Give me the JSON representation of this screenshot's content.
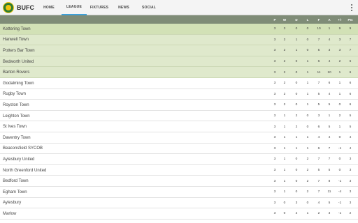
{
  "app": {
    "title": "BUFC"
  },
  "tabs": [
    {
      "label": "HOME"
    },
    {
      "label": "LEAGUE"
    },
    {
      "label": "FIXTURES"
    },
    {
      "label": "NEWS"
    },
    {
      "label": "SOCIAL"
    }
  ],
  "table": {
    "columns": [
      "P",
      "W",
      "D",
      "L",
      "F",
      "A",
      "+/-",
      "Pts"
    ],
    "rows": [
      {
        "team": "Kettering Town",
        "v": [
          "3",
          "3",
          "0",
          "0",
          "10",
          "1",
          "9",
          "9"
        ]
      },
      {
        "team": "Hanwell Town",
        "v": [
          "3",
          "2",
          "1",
          "0",
          "7",
          "4",
          "3",
          "7"
        ]
      },
      {
        "team": "Potters Bar Town",
        "v": [
          "3",
          "2",
          "1",
          "0",
          "5",
          "3",
          "3",
          "7"
        ]
      },
      {
        "team": "Bedworth United",
        "v": [
          "3",
          "2",
          "0",
          "1",
          "6",
          "4",
          "2",
          "6"
        ]
      },
      {
        "team": "Barton Rovers",
        "v": [
          "3",
          "2",
          "0",
          "1",
          "11",
          "10",
          "1",
          "6"
        ]
      },
      {
        "team": "Godalming Town",
        "v": [
          "3",
          "2",
          "0",
          "1",
          "7",
          "6",
          "1",
          "6"
        ]
      },
      {
        "team": "Rugby Town",
        "v": [
          "3",
          "2",
          "0",
          "1",
          "5",
          "4",
          "1",
          "6"
        ]
      },
      {
        "team": "Royston Town",
        "v": [
          "3",
          "2",
          "0",
          "1",
          "5",
          "5",
          "0",
          "6"
        ]
      },
      {
        "team": "Leighton Town",
        "v": [
          "3",
          "1",
          "2",
          "0",
          "3",
          "1",
          "2",
          "5"
        ]
      },
      {
        "team": "St Ives Town",
        "v": [
          "3",
          "1",
          "2",
          "0",
          "6",
          "5",
          "1",
          "5"
        ]
      },
      {
        "team": "Daventry Town",
        "v": [
          "3",
          "1",
          "1",
          "1",
          "4",
          "4",
          "0",
          "4"
        ]
      },
      {
        "team": "Beaconsfield SYCOB",
        "v": [
          "3",
          "1",
          "1",
          "1",
          "6",
          "7",
          "-1",
          "4"
        ]
      },
      {
        "team": "Aylesbury United",
        "v": [
          "3",
          "1",
          "0",
          "2",
          "7",
          "7",
          "0",
          "3"
        ]
      },
      {
        "team": "North Greenford United",
        "v": [
          "3",
          "1",
          "0",
          "2",
          "5",
          "5",
          "0",
          "3"
        ]
      },
      {
        "team": "Bedford Town",
        "v": [
          "3",
          "1",
          "0",
          "2",
          "7",
          "8",
          "-1",
          "3"
        ]
      },
      {
        "team": "Egham Town",
        "v": [
          "3",
          "1",
          "0",
          "2",
          "7",
          "11",
          "-4",
          "3"
        ]
      },
      {
        "team": "Aylesbury",
        "v": [
          "3",
          "0",
          "3",
          "0",
          "4",
          "5",
          "-1",
          "3"
        ]
      },
      {
        "team": "Marlow",
        "v": [
          "3",
          "0",
          "2",
          "1",
          "2",
          "3",
          "-1",
          "2"
        ]
      }
    ]
  }
}
